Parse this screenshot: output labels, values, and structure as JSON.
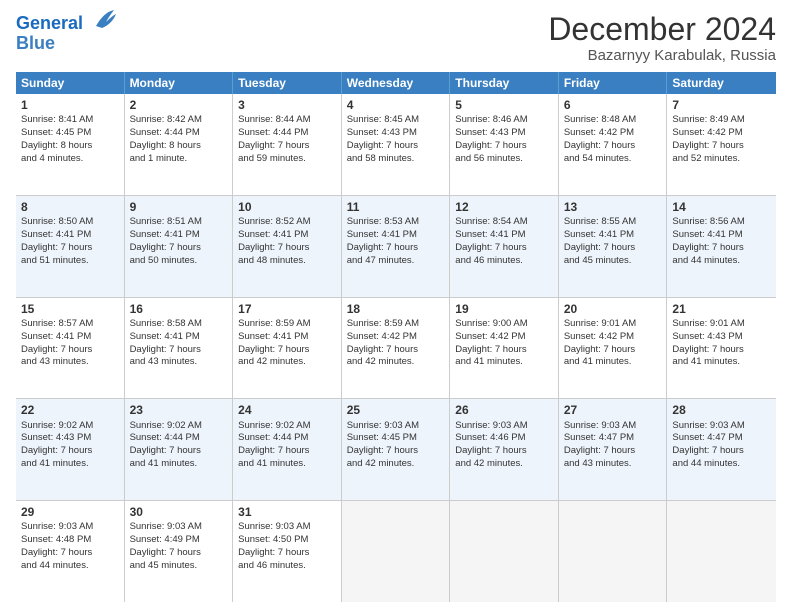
{
  "logo": {
    "line1": "General",
    "line2": "Blue"
  },
  "title": "December 2024",
  "subtitle": "Bazarnyy Karabulak, Russia",
  "headers": [
    "Sunday",
    "Monday",
    "Tuesday",
    "Wednesday",
    "Thursday",
    "Friday",
    "Saturday"
  ],
  "weeks": [
    [
      {
        "day": "1",
        "lines": [
          "Sunrise: 8:41 AM",
          "Sunset: 4:45 PM",
          "Daylight: 8 hours",
          "and 4 minutes."
        ]
      },
      {
        "day": "2",
        "lines": [
          "Sunrise: 8:42 AM",
          "Sunset: 4:44 PM",
          "Daylight: 8 hours",
          "and 1 minute."
        ]
      },
      {
        "day": "3",
        "lines": [
          "Sunrise: 8:44 AM",
          "Sunset: 4:44 PM",
          "Daylight: 7 hours",
          "and 59 minutes."
        ]
      },
      {
        "day": "4",
        "lines": [
          "Sunrise: 8:45 AM",
          "Sunset: 4:43 PM",
          "Daylight: 7 hours",
          "and 58 minutes."
        ]
      },
      {
        "day": "5",
        "lines": [
          "Sunrise: 8:46 AM",
          "Sunset: 4:43 PM",
          "Daylight: 7 hours",
          "and 56 minutes."
        ]
      },
      {
        "day": "6",
        "lines": [
          "Sunrise: 8:48 AM",
          "Sunset: 4:42 PM",
          "Daylight: 7 hours",
          "and 54 minutes."
        ]
      },
      {
        "day": "7",
        "lines": [
          "Sunrise: 8:49 AM",
          "Sunset: 4:42 PM",
          "Daylight: 7 hours",
          "and 52 minutes."
        ]
      }
    ],
    [
      {
        "day": "8",
        "lines": [
          "Sunrise: 8:50 AM",
          "Sunset: 4:41 PM",
          "Daylight: 7 hours",
          "and 51 minutes."
        ]
      },
      {
        "day": "9",
        "lines": [
          "Sunrise: 8:51 AM",
          "Sunset: 4:41 PM",
          "Daylight: 7 hours",
          "and 50 minutes."
        ]
      },
      {
        "day": "10",
        "lines": [
          "Sunrise: 8:52 AM",
          "Sunset: 4:41 PM",
          "Daylight: 7 hours",
          "and 48 minutes."
        ]
      },
      {
        "day": "11",
        "lines": [
          "Sunrise: 8:53 AM",
          "Sunset: 4:41 PM",
          "Daylight: 7 hours",
          "and 47 minutes."
        ]
      },
      {
        "day": "12",
        "lines": [
          "Sunrise: 8:54 AM",
          "Sunset: 4:41 PM",
          "Daylight: 7 hours",
          "and 46 minutes."
        ]
      },
      {
        "day": "13",
        "lines": [
          "Sunrise: 8:55 AM",
          "Sunset: 4:41 PM",
          "Daylight: 7 hours",
          "and 45 minutes."
        ]
      },
      {
        "day": "14",
        "lines": [
          "Sunrise: 8:56 AM",
          "Sunset: 4:41 PM",
          "Daylight: 7 hours",
          "and 44 minutes."
        ]
      }
    ],
    [
      {
        "day": "15",
        "lines": [
          "Sunrise: 8:57 AM",
          "Sunset: 4:41 PM",
          "Daylight: 7 hours",
          "and 43 minutes."
        ]
      },
      {
        "day": "16",
        "lines": [
          "Sunrise: 8:58 AM",
          "Sunset: 4:41 PM",
          "Daylight: 7 hours",
          "and 43 minutes."
        ]
      },
      {
        "day": "17",
        "lines": [
          "Sunrise: 8:59 AM",
          "Sunset: 4:41 PM",
          "Daylight: 7 hours",
          "and 42 minutes."
        ]
      },
      {
        "day": "18",
        "lines": [
          "Sunrise: 8:59 AM",
          "Sunset: 4:42 PM",
          "Daylight: 7 hours",
          "and 42 minutes."
        ]
      },
      {
        "day": "19",
        "lines": [
          "Sunrise: 9:00 AM",
          "Sunset: 4:42 PM",
          "Daylight: 7 hours",
          "and 41 minutes."
        ]
      },
      {
        "day": "20",
        "lines": [
          "Sunrise: 9:01 AM",
          "Sunset: 4:42 PM",
          "Daylight: 7 hours",
          "and 41 minutes."
        ]
      },
      {
        "day": "21",
        "lines": [
          "Sunrise: 9:01 AM",
          "Sunset: 4:43 PM",
          "Daylight: 7 hours",
          "and 41 minutes."
        ]
      }
    ],
    [
      {
        "day": "22",
        "lines": [
          "Sunrise: 9:02 AM",
          "Sunset: 4:43 PM",
          "Daylight: 7 hours",
          "and 41 minutes."
        ]
      },
      {
        "day": "23",
        "lines": [
          "Sunrise: 9:02 AM",
          "Sunset: 4:44 PM",
          "Daylight: 7 hours",
          "and 41 minutes."
        ]
      },
      {
        "day": "24",
        "lines": [
          "Sunrise: 9:02 AM",
          "Sunset: 4:44 PM",
          "Daylight: 7 hours",
          "and 41 minutes."
        ]
      },
      {
        "day": "25",
        "lines": [
          "Sunrise: 9:03 AM",
          "Sunset: 4:45 PM",
          "Daylight: 7 hours",
          "and 42 minutes."
        ]
      },
      {
        "day": "26",
        "lines": [
          "Sunrise: 9:03 AM",
          "Sunset: 4:46 PM",
          "Daylight: 7 hours",
          "and 42 minutes."
        ]
      },
      {
        "day": "27",
        "lines": [
          "Sunrise: 9:03 AM",
          "Sunset: 4:47 PM",
          "Daylight: 7 hours",
          "and 43 minutes."
        ]
      },
      {
        "day": "28",
        "lines": [
          "Sunrise: 9:03 AM",
          "Sunset: 4:47 PM",
          "Daylight: 7 hours",
          "and 44 minutes."
        ]
      }
    ],
    [
      {
        "day": "29",
        "lines": [
          "Sunrise: 9:03 AM",
          "Sunset: 4:48 PM",
          "Daylight: 7 hours",
          "and 44 minutes."
        ]
      },
      {
        "day": "30",
        "lines": [
          "Sunrise: 9:03 AM",
          "Sunset: 4:49 PM",
          "Daylight: 7 hours",
          "and 45 minutes."
        ]
      },
      {
        "day": "31",
        "lines": [
          "Sunrise: 9:03 AM",
          "Sunset: 4:50 PM",
          "Daylight: 7 hours",
          "and 46 minutes."
        ]
      },
      null,
      null,
      null,
      null
    ]
  ]
}
